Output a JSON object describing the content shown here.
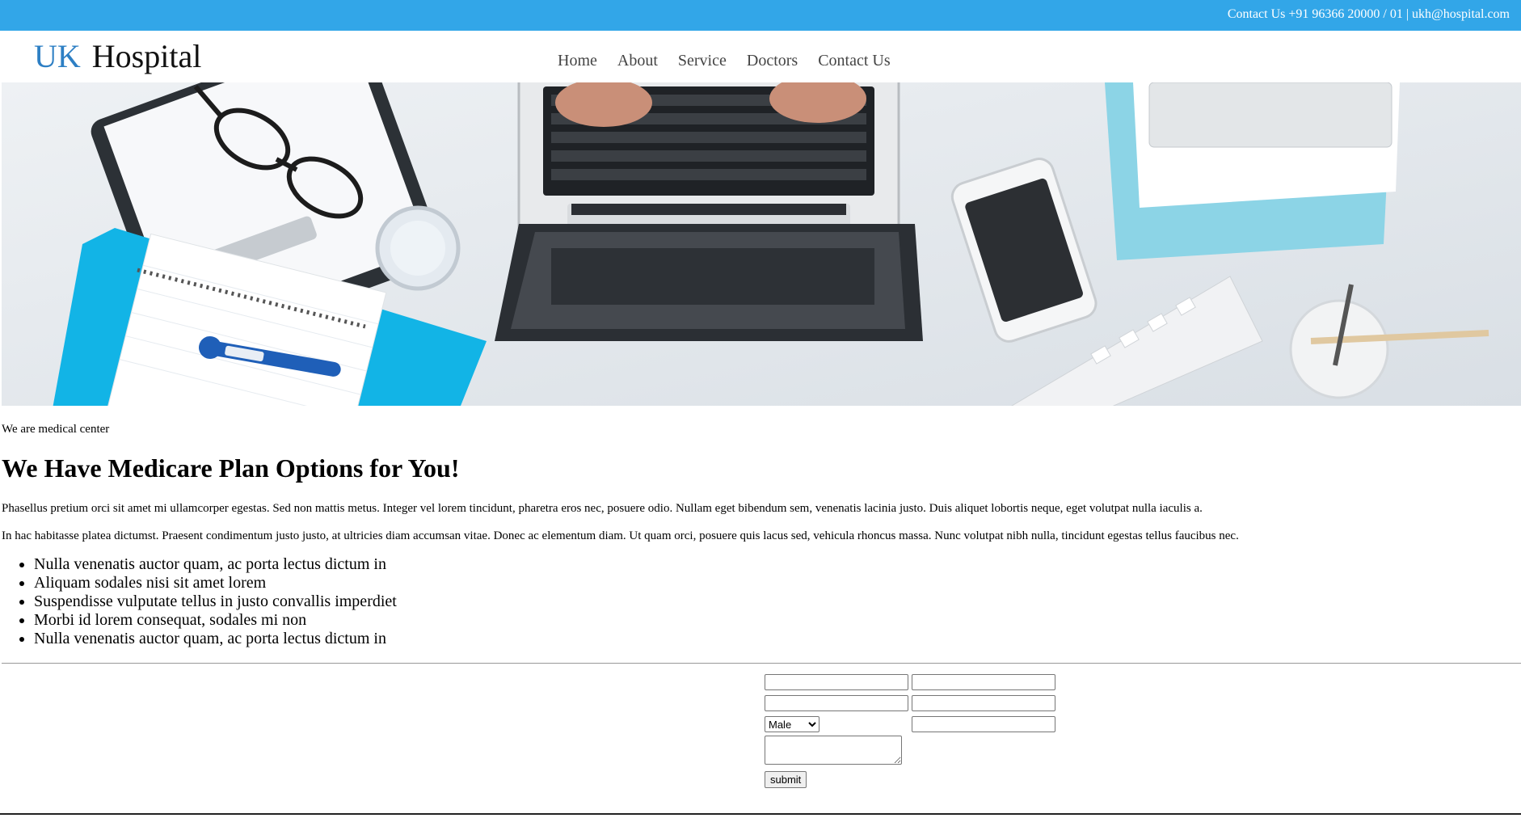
{
  "topbar": {
    "contact_text": "Contact Us +91 96366 20000 / 01 | ukh@hospital.com",
    "bg_color": "#32a6e8"
  },
  "header": {
    "logo_uk": "UK",
    "logo_hospital": "Hospital",
    "logo_accent": "#2d7fc4",
    "nav": [
      "Home",
      "About",
      "Service",
      "Doctors",
      "Contact Us"
    ]
  },
  "hero": {
    "icon": "hero-desk-photo"
  },
  "content": {
    "tagline": "We are medical center",
    "heading": "We Have Medicare Plan Options for You!",
    "para1": "Phasellus pretium orci sit amet mi ullamcorper egestas. Sed non mattis metus. Integer vel lorem tincidunt, pharetra eros nec, posuere odio. Nullam eget bibendum sem, venenatis lacinia justo. Duis aliquet lobortis neque, eget volutpat nulla iaculis a.",
    "para2": "In hac habitasse platea dictumst. Praesent condimentum justo justo, at ultricies diam accumsan vitae. Donec ac elementum diam. Ut quam orci, posuere quis lacus sed, vehicula rhoncus massa. Nunc volutpat nibh nulla, tincidunt egestas tellus faucibus nec.",
    "features": [
      "Nulla venenatis auctor quam, ac porta lectus dictum in",
      "Aliquam sodales nisi sit amet lorem",
      "Suspendisse vulputate tellus in justo convallis imperdiet",
      "Morbi id lorem consequat, sodales mi non",
      "Nulla venenatis auctor quam, ac porta lectus dictum in"
    ]
  },
  "form": {
    "gender_selected": "Male",
    "submit_label": "submit",
    "fields": [
      "",
      "",
      "",
      "",
      ""
    ]
  }
}
